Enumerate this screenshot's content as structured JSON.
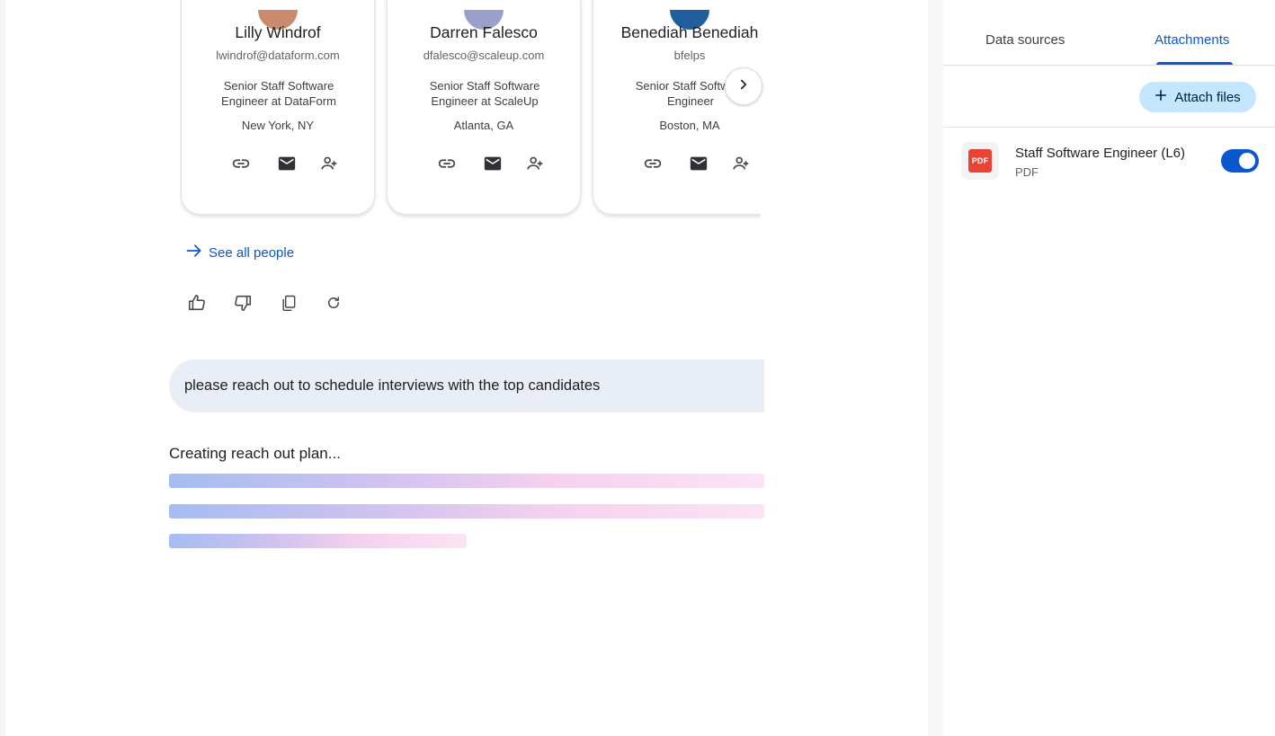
{
  "people": [
    {
      "name": "Lilly Windrof",
      "email": "lwindrof@dataform.com",
      "role": "Senior Staff Software Engineer at DataForm",
      "location": "New York, NY"
    },
    {
      "name": "Darren Falesco",
      "email": "dfalesco@scaleup.com",
      "role": "Senior Staff Software Engineer at ScaleUp",
      "location": "Atlanta, GA"
    },
    {
      "name": "Benediah Benediah",
      "email": "bfelps",
      "role": "Senior Staff Software Engineer",
      "location": "Boston, MA"
    }
  ],
  "see_all_label": "See all people",
  "prompt_text": "please reach out to schedule interviews with the top candidates",
  "status_text": "Creating reach out plan...",
  "panel": {
    "tabs": {
      "data_sources": "Data sources",
      "attachments": "Attachments"
    },
    "attach_button": "Attach files",
    "file": {
      "name": "Staff Software Engineer (L6)",
      "type": "PDF",
      "badge": "PDF",
      "enabled": true
    }
  },
  "colors": {
    "accent": "#0b57d0",
    "prompt_bg": "#e9edf6",
    "chip_bg": "#c2e7ff",
    "pdf_red": "#ea4335"
  },
  "icons": [
    "link-icon",
    "mail-icon",
    "person-add-icon",
    "arrow-right-icon",
    "chevron-right-icon",
    "thumb-up-icon",
    "thumb-down-icon",
    "copy-icon",
    "refresh-icon",
    "plus-icon",
    "pdf-icon"
  ]
}
